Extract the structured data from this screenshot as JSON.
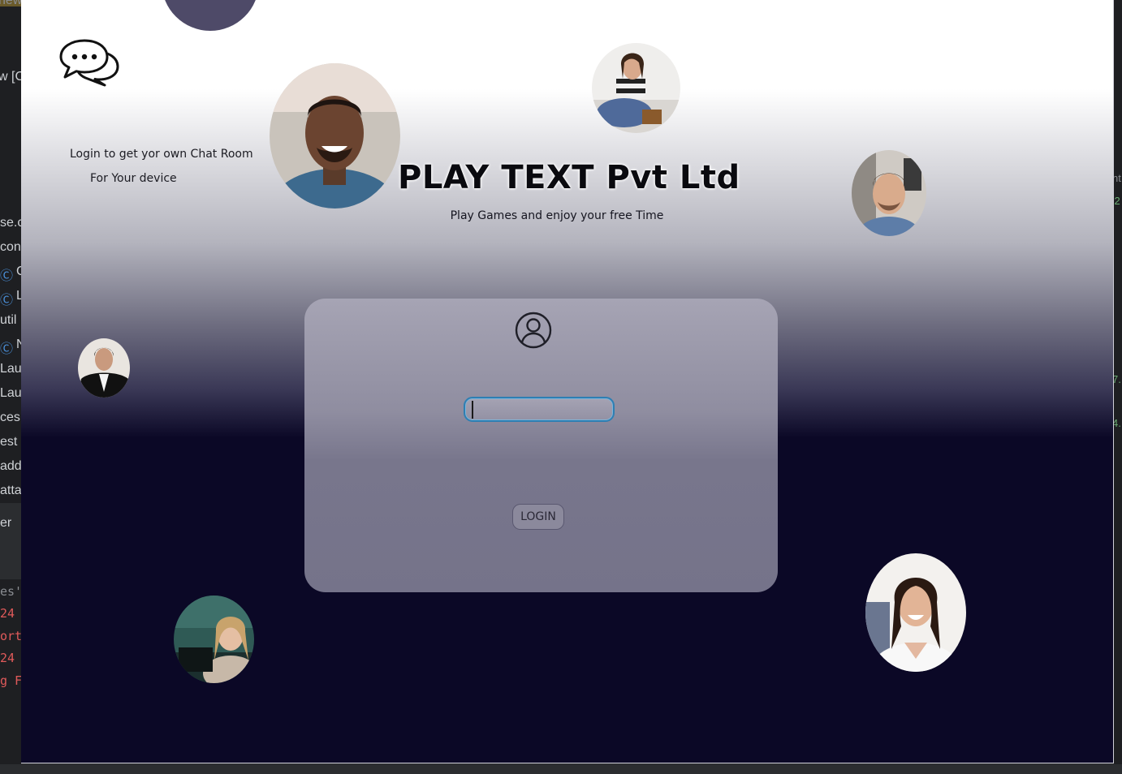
{
  "background_ide": {
    "top_fragment": "new",
    "left_lines": [
      "w [C",
      "se.c",
      "con",
      "C",
      "L",
      "util",
      "N",
      "Lau",
      "Lau",
      "ces",
      "est",
      "add",
      "atta",
      "er"
    ],
    "console_lines": [
      "es'",
      "24",
      "ort",
      "24",
      "g F"
    ],
    "right_lines": [
      "nt",
      "'2",
      "7.",
      "4."
    ]
  },
  "app": {
    "promo": {
      "line1": "Login to get yor own Chat Room",
      "line2": "For Your device"
    },
    "brand": {
      "title": "PLAY TEXT Pvt Ltd",
      "subtitle": "Play Games and enjoy your free Time"
    },
    "login": {
      "username_value": "",
      "button_label": "LOGIN"
    },
    "icons": {
      "chat": "speech-bubbles-icon",
      "user": "user-circle-icon"
    }
  },
  "colors": {
    "window_top": "#ffffff",
    "window_bottom": "#0b0826",
    "card": "#78768c",
    "input_border": "#2e7fb3"
  }
}
